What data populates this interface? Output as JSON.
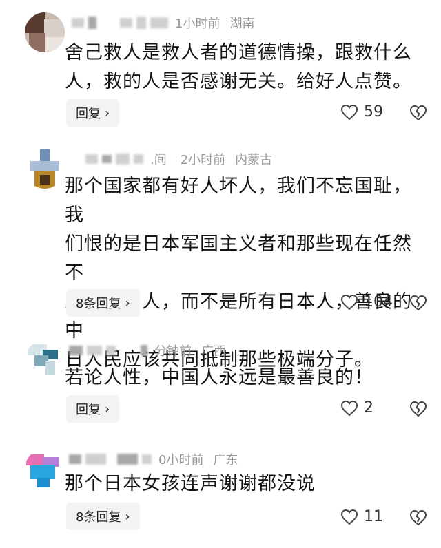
{
  "comments": [
    {
      "time": "1小时前",
      "location": "湖南",
      "lines": [
        "舍己救人是救人者的道德情操，跟救什么",
        "人，救的人是否感谢无关。给好人点赞。"
      ],
      "reply_label": "回复",
      "likes": "59"
    },
    {
      "name_tail": ".间",
      "time": "2小时前",
      "location": "内蒙古",
      "lines": [
        "那个国家都有好人坏人，我们不忘国耻，我",
        "们恨的是日本军国主义者和那些现在任然不",
        "思悔改的人，而不是所有日本人，善良的中",
        "日人民应该共同抵制那些极端分子。"
      ],
      "reply_label": "8条回复",
      "likes": "104"
    },
    {
      "time": "分钟前",
      "location": "广西",
      "lines": [
        "若论人性，中国人永远是最善良的！"
      ],
      "reply_label": "回复",
      "likes": "2"
    },
    {
      "time": "0小时前",
      "location": "广东",
      "lines": [
        "那个日本女孩连声谢谢都没说"
      ],
      "reply_label": "8条回复",
      "likes": "11"
    }
  ],
  "icons": {
    "reply_chevron": "chevron-right-icon",
    "like": "heart-outline-icon",
    "dislike": "broken-heart-icon"
  }
}
